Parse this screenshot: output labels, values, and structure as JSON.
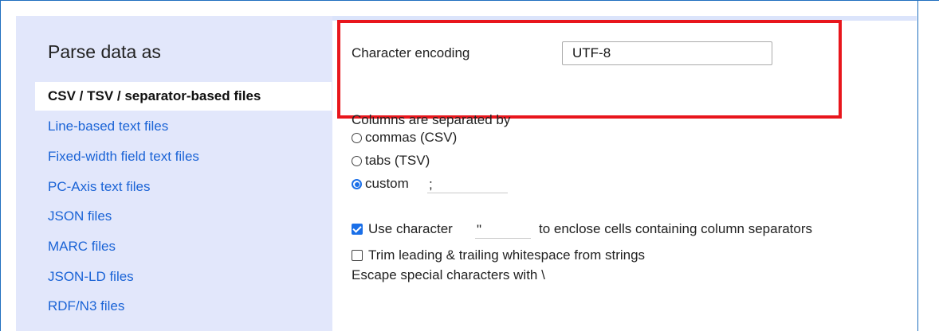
{
  "sidebar": {
    "title": "Parse data as",
    "items": [
      {
        "label": "CSV / TSV / separator-based files",
        "active": true
      },
      {
        "label": "Line-based text files",
        "active": false
      },
      {
        "label": "Fixed-width field text files",
        "active": false
      },
      {
        "label": "PC-Axis text files",
        "active": false
      },
      {
        "label": "JSON files",
        "active": false
      },
      {
        "label": "MARC files",
        "active": false
      },
      {
        "label": "JSON-LD files",
        "active": false
      },
      {
        "label": "RDF/N3 files",
        "active": false
      }
    ]
  },
  "encoding": {
    "label": "Character encoding",
    "value": "UTF-8"
  },
  "separator": {
    "heading": "Columns are separated by",
    "options": [
      {
        "label": "commas (CSV)",
        "checked": false
      },
      {
        "label": "tabs (TSV)",
        "checked": false
      },
      {
        "label": "custom",
        "checked": true
      }
    ],
    "custom_value": ";"
  },
  "quote": {
    "checked": true,
    "label_before": "Use character",
    "value": "\"",
    "label_after": "to enclose cells containing column separators"
  },
  "trim": {
    "checked": false,
    "label": "Trim leading & trailing whitespace from strings"
  },
  "escape": {
    "label": "Escape special characters with \\"
  },
  "colors": {
    "sidebar_bg": "#e2e7fb",
    "link": "#1a63d6",
    "highlight": "#e8161c",
    "accent": "#1a6fe8"
  }
}
